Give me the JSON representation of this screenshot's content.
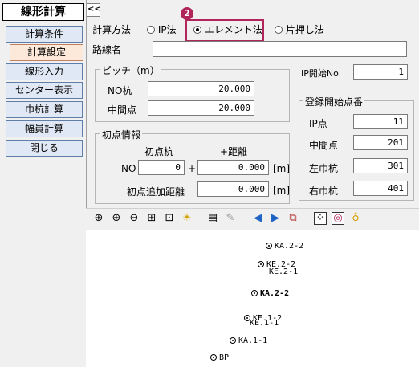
{
  "app_title": "線形計算",
  "collapse_label": "<<",
  "sidebar": [
    {
      "label": "計算条件"
    },
    {
      "label": "計算設定",
      "active": true
    },
    {
      "label": "線形入力"
    },
    {
      "label": "センター表示"
    },
    {
      "label": "巾杭計算"
    },
    {
      "label": "幅員計算"
    },
    {
      "label": "閉じる"
    }
  ],
  "calc_method": {
    "label": "計算方法",
    "options": [
      "IP法",
      "エレメント法",
      "片押し法"
    ],
    "selected": "エレメント法",
    "callout_number": "2"
  },
  "route_name": {
    "label": "路線名",
    "value": ""
  },
  "pitch": {
    "title": "ピッチ（m）",
    "no_pile_label": "NO杭",
    "no_pile_value": "20.000",
    "intermediate_label": "中間点",
    "intermediate_value": "20.000"
  },
  "ip_start": {
    "label": "IP開始No",
    "value": "1"
  },
  "registration_start": {
    "title": "登録開始点番",
    "ip_label": "IP点",
    "ip_value": "11",
    "intermediate_label": "中間点",
    "intermediate_value": "201",
    "left_label": "左巾杭",
    "left_value": "301",
    "right_label": "右巾杭",
    "right_value": "401"
  },
  "initial_point": {
    "title": "初点情報",
    "pile_header": "初点杭",
    "distance_header": "+距離",
    "no_label": "NO",
    "no_value": "0",
    "plus_sign": "+",
    "distance_value": "0.000",
    "distance_unit": "[m]",
    "additional_label": "初点追加距離",
    "additional_value": "0.000",
    "additional_unit": "[m]"
  },
  "toolbar_icons": [
    "zoom-fit-icon",
    "zoom-in-icon",
    "zoom-out-icon",
    "pan-icon",
    "zoom-window-icon",
    "light-icon",
    "print-icon",
    "edit-icon",
    "prev-icon",
    "next-icon",
    "layout-icon",
    "grid-select-icon",
    "point-select-icon",
    "marker-icon"
  ],
  "canvas_points": [
    {
      "label": "KA.2-2",
      "bold": false
    },
    {
      "label": "KE.2-2",
      "bold": false
    },
    {
      "label": "KE.2-1",
      "bold": false
    },
    {
      "label": "KA.2-2",
      "bold": true
    },
    {
      "label": "KE.1-2",
      "bold": false
    },
    {
      "label": "KE.1-1",
      "bold": false
    },
    {
      "label": "KA.1-1",
      "bold": false
    },
    {
      "label": "BP",
      "bold": false
    }
  ],
  "colors": {
    "accent": "#b0265a",
    "nav_bg": "#dfe8f4",
    "nav_border": "#5f7ea8",
    "active_bg": "#fde9d9"
  }
}
